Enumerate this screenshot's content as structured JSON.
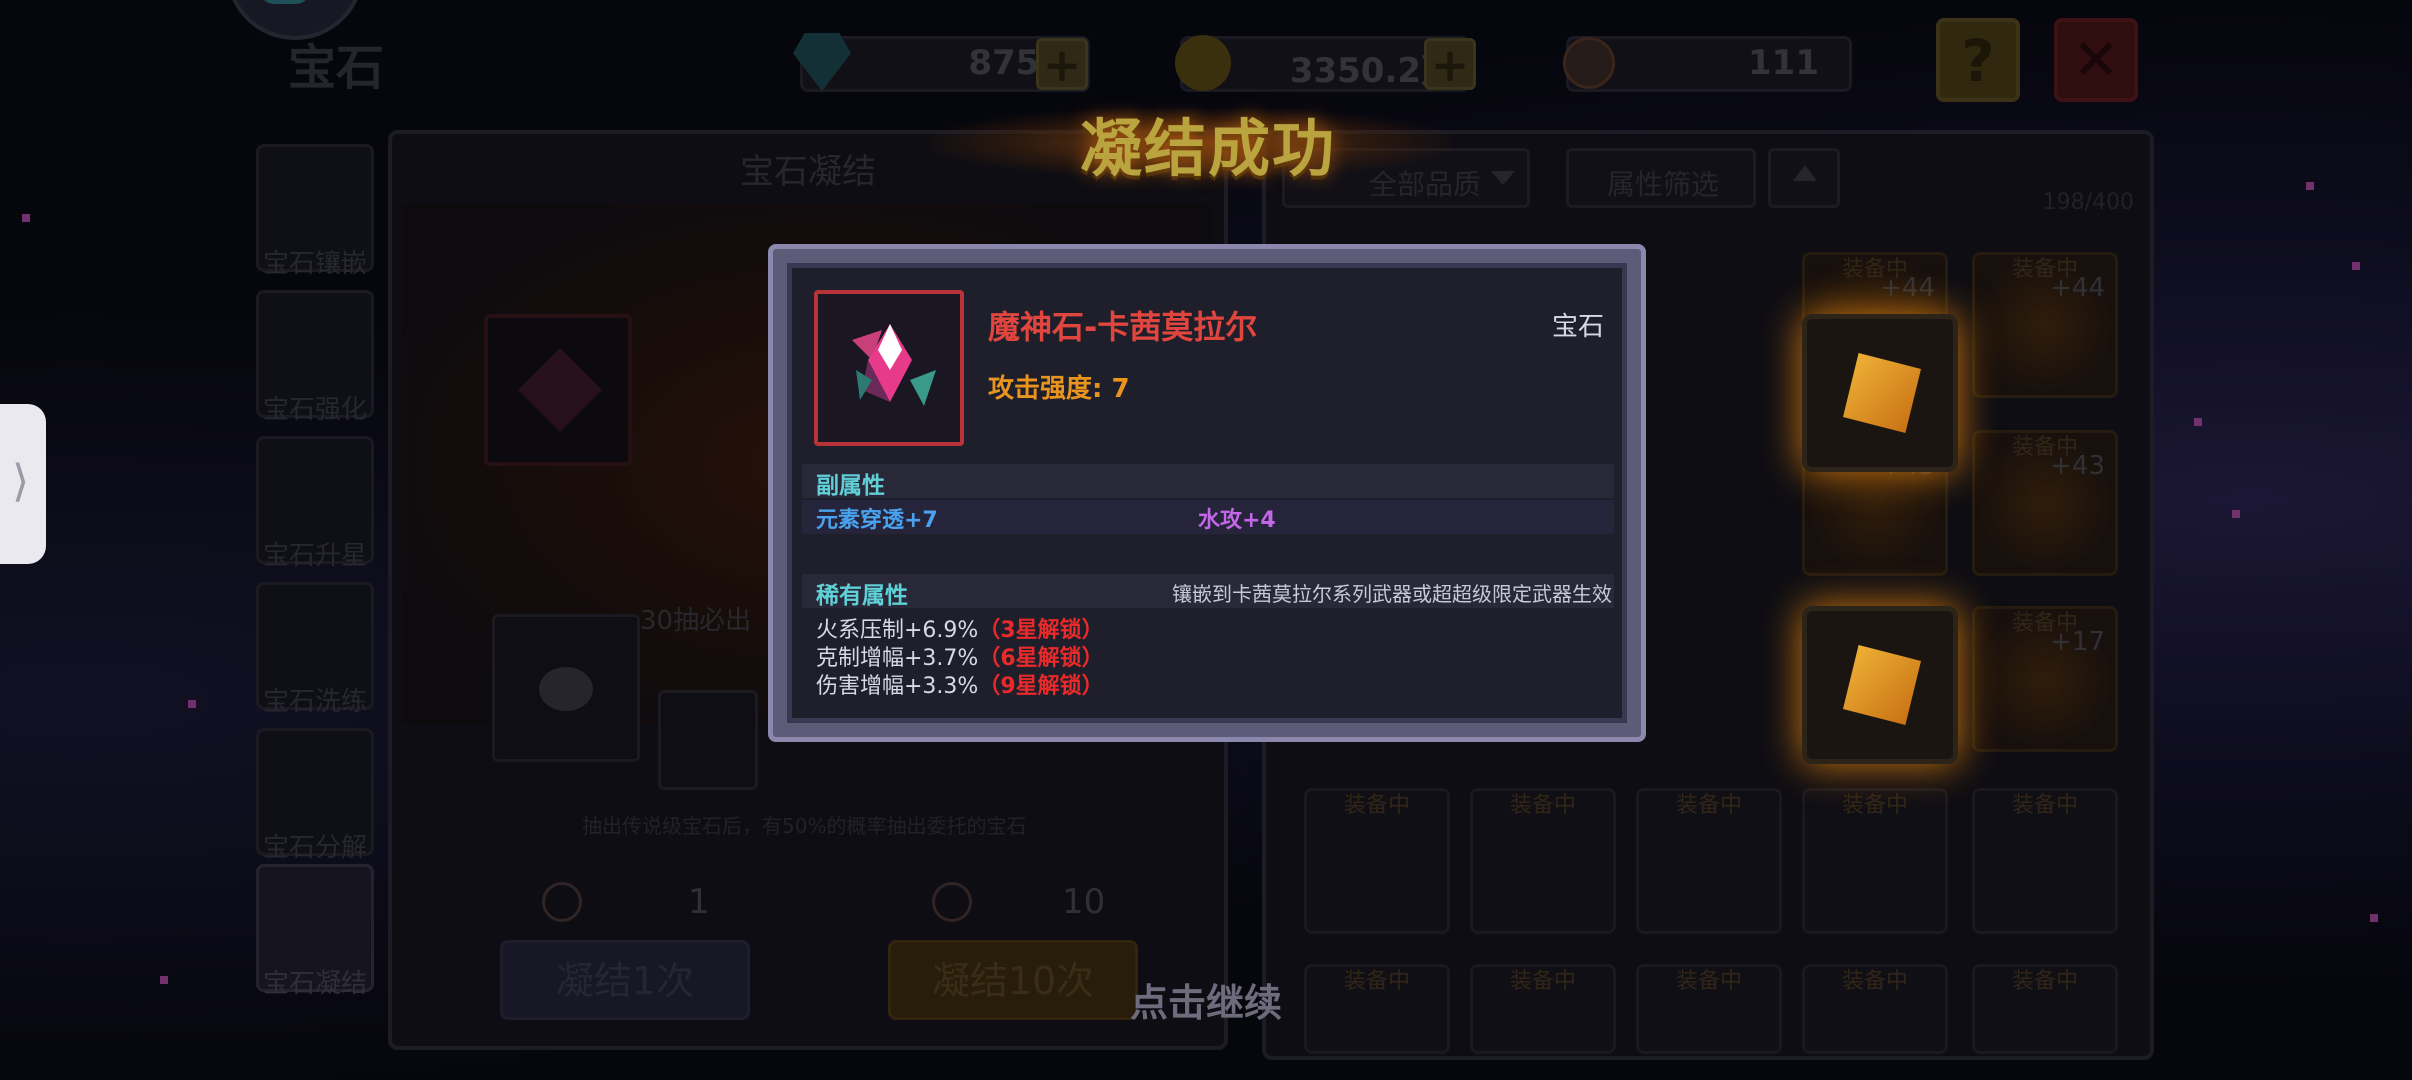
{
  "header": {
    "title": "宝石",
    "gem_count": "8753",
    "gold_count": "3350.2万",
    "token_count": "111",
    "help_label": "?",
    "close_label": "✕"
  },
  "sidebar": {
    "items": [
      {
        "label": "宝石镶嵌"
      },
      {
        "label": "宝石强化"
      },
      {
        "label": "宝石升星"
      },
      {
        "label": "宝石洗练"
      },
      {
        "label": "宝石分解"
      },
      {
        "label": "宝石凝结"
      }
    ]
  },
  "condense_panel": {
    "title": "宝石凝结",
    "guarantee_text": "30抽必出",
    "note": "抽出传说级宝石后，有50%的概率抽出委托的宝石",
    "cost_1": "1",
    "cost_10": "10",
    "button_1": "凝结1次",
    "button_10": "凝结10次"
  },
  "inventory": {
    "filter_quality": "全部品质",
    "filter_attr": "属性筛选",
    "count": "198/400",
    "equipped_tag": "装备中",
    "levels": [
      "+44",
      "+44",
      "+43",
      "+43",
      "+17"
    ]
  },
  "banner": {
    "title": "凝结成功"
  },
  "popup": {
    "item_name": "魔神石-卡茜莫拉尔",
    "item_type": "宝石",
    "attack": "攻击强度: 7",
    "sub_attr_header": "副属性",
    "sub_attr_1": "元素穿透+7",
    "sub_attr_2": "水攻+4",
    "rare_attr_header": "稀有属性",
    "rare_attr_note": "镶嵌到卡茜莫拉尔系列武器或超超级限定武器生效",
    "rare_attrs": [
      {
        "text": "火系压制+6.9%",
        "unlock": "（3星解锁）"
      },
      {
        "text": "克制增幅+3.7%",
        "unlock": "（6星解锁）"
      },
      {
        "text": "伤害增幅+3.3%",
        "unlock": "（9星解锁）"
      }
    ]
  },
  "continue_text": "点击继续",
  "colors": {
    "name_red": "#e0453e",
    "attack_orange": "#e8941e",
    "header_cyan": "#5fd0d6",
    "sub_blue": "#4aa2ef",
    "sub_purple": "#c466e8",
    "unlock_red": "#e82a2a"
  }
}
